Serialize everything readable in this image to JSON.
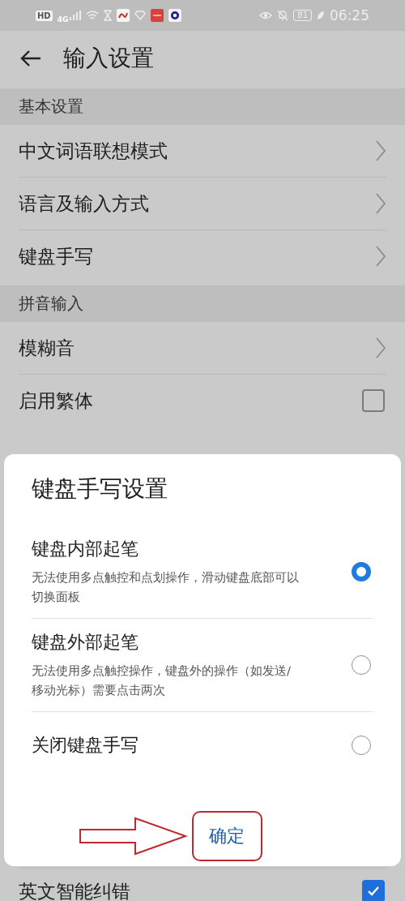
{
  "status_bar": {
    "labels": [
      "HD",
      "4G"
    ],
    "battery": "81",
    "time": "06:25"
  },
  "header": {
    "title": "输入设置"
  },
  "sections": [
    {
      "title": "基本设置",
      "items": [
        {
          "label": "中文词语联想模式",
          "kind": "link"
        },
        {
          "label": "语言及输入方式",
          "kind": "link"
        },
        {
          "label": "键盘手写",
          "kind": "link"
        }
      ]
    },
    {
      "title": "拼音输入",
      "items": [
        {
          "label": "模糊音",
          "kind": "link"
        },
        {
          "label": "启用繁体",
          "kind": "checkbox",
          "checked": false
        }
      ]
    }
  ],
  "dialog": {
    "title": "键盘手写设置",
    "options": [
      {
        "label": "键盘内部起笔",
        "description": "无法使用多点触控和点划操作，滑动键盘底部可以切换面板",
        "selected": true
      },
      {
        "label": "键盘外部起笔",
        "description": "无法使用多点触控操作，键盘外的操作（如发送/移动光标）需要点击两次",
        "selected": false
      },
      {
        "label": "关闭键盘手写",
        "selected": false
      }
    ],
    "confirm": {
      "label": "确定",
      "highlighted": true
    }
  },
  "footer_items": [
    {
      "label": "英文智能纠错",
      "kind": "checkbox",
      "checked": true
    }
  ]
}
